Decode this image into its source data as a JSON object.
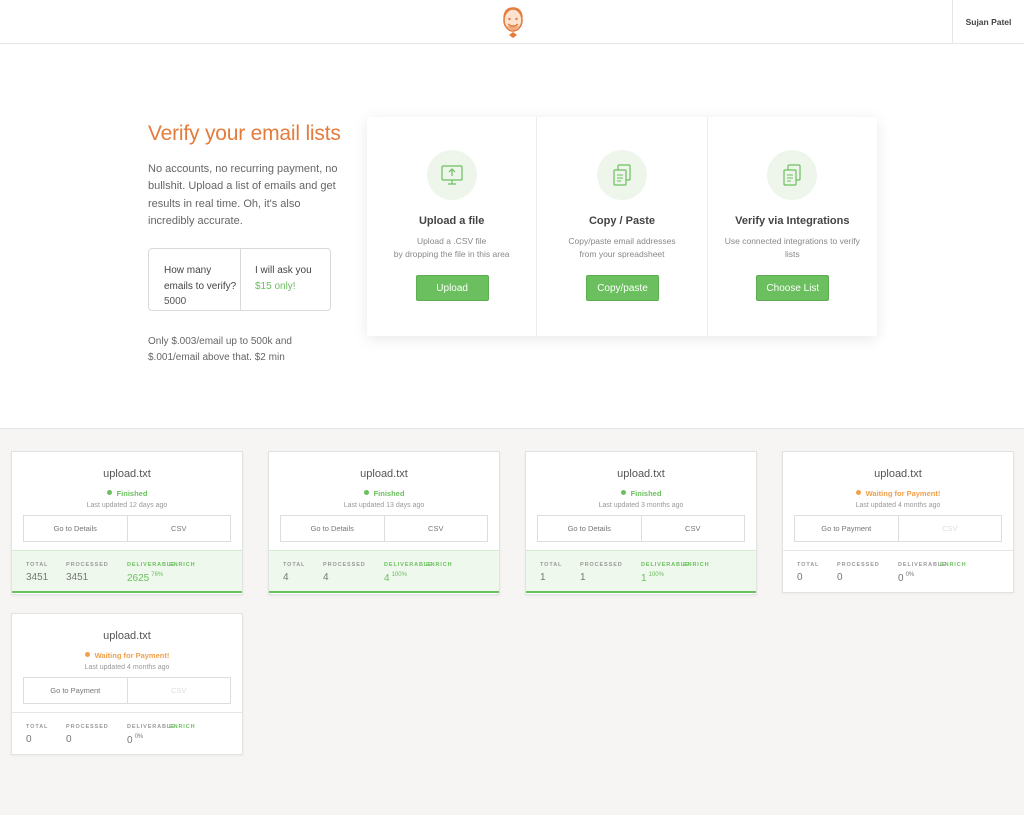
{
  "header": {
    "user_name": "Sujan Patel",
    "logo": "mascot-face-logo"
  },
  "hero": {
    "title": "Verify your email lists",
    "description": "No accounts, no recurring payment, no bullshit. Upload a list of emails and get results in real time. Oh, it's also incredibly accurate.",
    "calc_question": "How many emails to verify?",
    "calc_quantity": "5000",
    "calc_ask": "I will ask you",
    "calc_price": "$15 only!",
    "pricing_note": "Only $.003/email up to 500k and $.001/email above that. $2 min"
  },
  "options": [
    {
      "icon": "monitor-upload-icon",
      "title": "Upload a file",
      "subtitle_1": "Upload a .CSV file",
      "subtitle_2": "by dropping the file in this area",
      "button": "Upload"
    },
    {
      "icon": "copy-documents-icon",
      "title": "Copy / Paste",
      "subtitle_1": "Copy/paste email addresses",
      "subtitle_2": "from your spreadsheet",
      "button": "Copy/paste"
    },
    {
      "icon": "copy-documents-icon",
      "title": "Verify via Integrations",
      "subtitle_1": "Use connected integrations to verify",
      "subtitle_2": "lists",
      "button": "Choose List"
    }
  ],
  "stat_labels": {
    "total": "TOTAL",
    "processed": "PROCESSED",
    "deliverable": "DELIVERABLE",
    "enrich": "ENRICH"
  },
  "cards": [
    {
      "file": "upload.txt",
      "status": "Finished",
      "updated": "Last updated 12 days ago",
      "action_1": "Go to Details",
      "action_2": "CSV",
      "total": "3451",
      "processed": "3451",
      "deliverable": "2625",
      "pct": "76%"
    },
    {
      "file": "upload.txt",
      "status": "Finished",
      "updated": "Last updated 13 days ago",
      "action_1": "Go to Details",
      "action_2": "CSV",
      "total": "4",
      "processed": "4",
      "deliverable": "4",
      "pct": "100%"
    },
    {
      "file": "upload.txt",
      "status": "Finished",
      "updated": "Last updated 3 months ago",
      "action_1": "Go to Details",
      "action_2": "CSV",
      "total": "1",
      "processed": "1",
      "deliverable": "1",
      "pct": "100%"
    },
    {
      "file": "upload.txt",
      "status": "Waiting for Payment!",
      "updated": "Last updated 4 months ago",
      "action_1": "Go to Payment",
      "action_2": "CSV",
      "total": "0",
      "processed": "0",
      "deliverable": "0",
      "pct": "0%"
    },
    {
      "file": "upload.txt",
      "status": "Waiting for Payment!",
      "updated": "Last updated 4 months ago",
      "action_1": "Go to Payment",
      "action_2": "CSV",
      "total": "0",
      "processed": "0",
      "deliverable": "0",
      "pct": "0%"
    }
  ],
  "colors": {
    "accent_orange": "#e47c3d",
    "accent_green": "#6bbf5e",
    "waiting_orange": "#f0a04b"
  }
}
